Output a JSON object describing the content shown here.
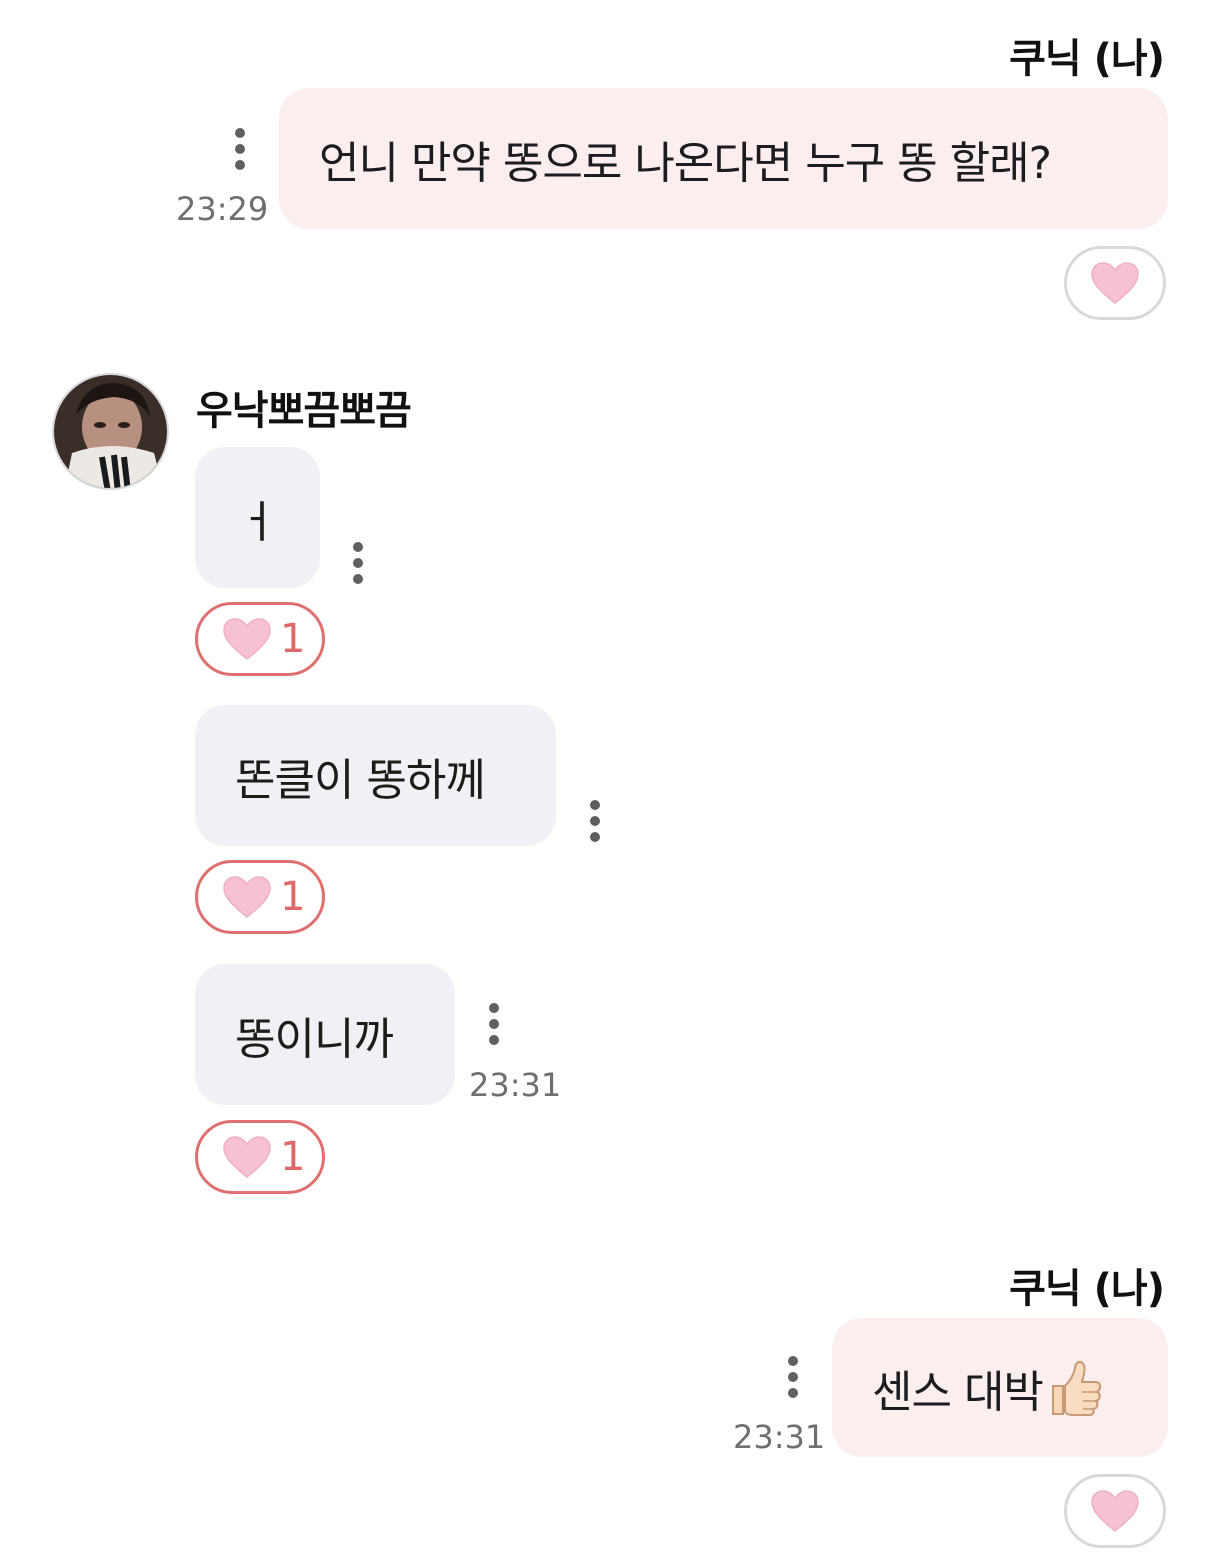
{
  "messages": [
    {
      "sender": "쿠닉 (나)",
      "text": "언니 만약 똥으로 나온다면 누구 똥 할래?",
      "time": "23:29"
    },
    {
      "sender": "우낙뽀끔뽀끔",
      "items": [
        {
          "text": "ㅓ",
          "reaction_count": "1"
        },
        {
          "text": "똔클이 똥하께",
          "reaction_count": "1"
        },
        {
          "text": "똥이니까",
          "reaction_count": "1",
          "time": "23:31"
        }
      ]
    },
    {
      "sender": "쿠닉 (나)",
      "text": "센스 대박",
      "emoji": "thumbs-up-icon",
      "time": "23:31"
    }
  ],
  "colors": {
    "my_bubble": "#fbeeee",
    "their_bubble": "#f1f1f5",
    "reaction_active_border": "#e07070",
    "reaction_count": "#e06868",
    "heart": "#f6c2d2"
  }
}
